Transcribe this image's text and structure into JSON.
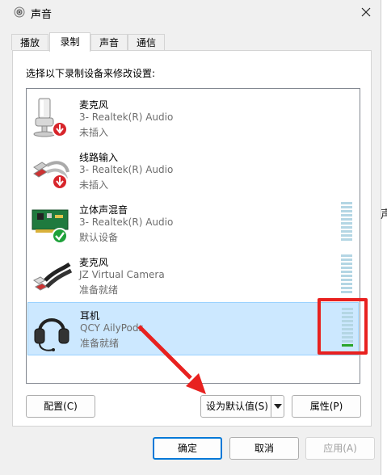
{
  "window": {
    "title": "声音",
    "icon": "speaker-icon"
  },
  "tabs": [
    {
      "label": "播放",
      "active": false
    },
    {
      "label": "录制",
      "active": true
    },
    {
      "label": "声音",
      "active": false
    },
    {
      "label": "通信",
      "active": false
    }
  ],
  "instruction": "选择以下录制设备来修改设置:",
  "devices": [
    {
      "name": "麦克风",
      "description": "3- Realtek(R) Audio",
      "status": "未插入",
      "icon": "microphone-icon",
      "badge": "unplugged-badge-icon",
      "selected": false,
      "meter": false
    },
    {
      "name": "线路输入",
      "description": "3- Realtek(R) Audio",
      "status": "未插入",
      "icon": "line-in-cable-icon",
      "badge": "unplugged-badge-icon",
      "selected": false,
      "meter": false
    },
    {
      "name": "立体声混音",
      "description": "3- Realtek(R) Audio",
      "status": "默认设备",
      "icon": "sound-card-icon",
      "badge": "default-check-badge-icon",
      "selected": false,
      "meter": true
    },
    {
      "name": "麦克风",
      "description": "JZ Virtual Camera",
      "status": "准备就绪",
      "icon": "audio-cable-icon",
      "badge": "",
      "selected": false,
      "meter": true
    },
    {
      "name": "耳机",
      "description": "QCY AilyPods",
      "status": "准备就绪",
      "icon": "headset-icon",
      "badge": "",
      "selected": true,
      "meter": true,
      "meter_level": 0.05
    }
  ],
  "buttons": {
    "configure": "配置(C)",
    "set_default": "设为默认值(S)",
    "properties": "属性(P)",
    "ok": "确定",
    "cancel": "取消",
    "apply": "应用(A)"
  },
  "behind_text": "声",
  "colors": {
    "highlight": "#e8211f",
    "selection": "#cce8ff",
    "meter_idle": "#b4d6e4",
    "meter_active": "#2aa52a",
    "primary_border": "#0078d7"
  }
}
